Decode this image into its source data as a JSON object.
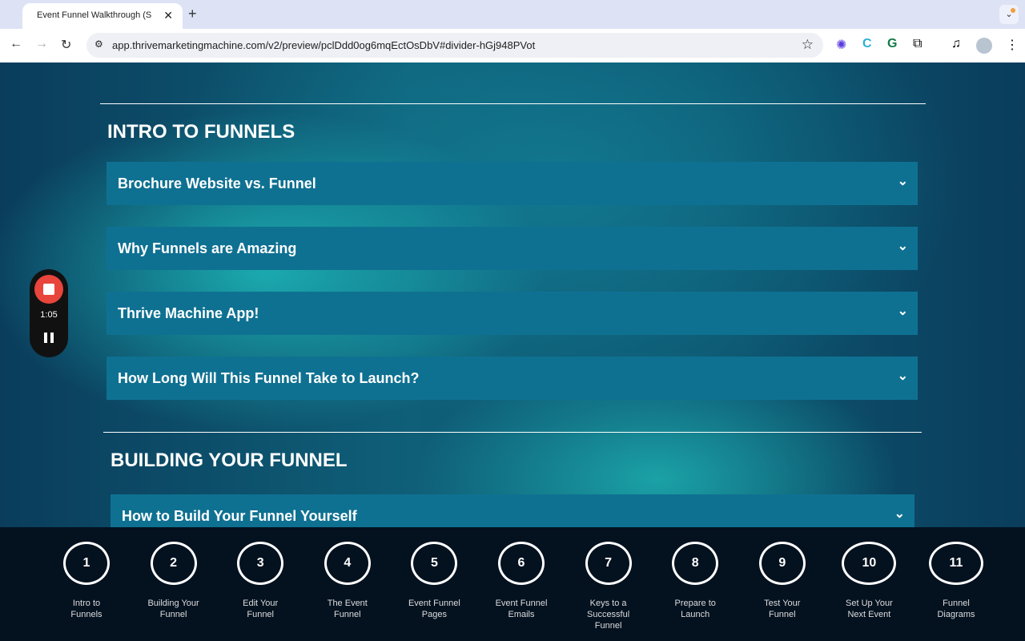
{
  "browser": {
    "tab_title": "Event Funnel Walkthrough (S",
    "url": "app.thrivemarketingmachine.com/v2/preview/pclDdd0og6mqEctOsDbV#divider-hGj948PVot"
  },
  "sections": [
    {
      "title": "INTRO TO FUNNELS",
      "items": [
        "Brochure Website vs. Funnel",
        "Why Funnels are Amazing",
        "Thrive Machine App!",
        "How Long Will This Funnel Take to Launch?"
      ]
    },
    {
      "title": "BUILDING YOUR FUNNEL",
      "items": [
        "How to Build Your Funnel Yourself"
      ]
    }
  ],
  "recorder": {
    "time": "1:05"
  },
  "steps": [
    {
      "num": "1",
      "label": "Intro to Funnels"
    },
    {
      "num": "2",
      "label": "Building Your Funnel"
    },
    {
      "num": "3",
      "label": "Edit Your Funnel"
    },
    {
      "num": "4",
      "label": "The Event Funnel"
    },
    {
      "num": "5",
      "label": "Event Funnel Pages"
    },
    {
      "num": "6",
      "label": "Event Funnel Emails"
    },
    {
      "num": "7",
      "label": "Keys to a Successful Funnel"
    },
    {
      "num": "8",
      "label": "Prepare to Launch"
    },
    {
      "num": "9",
      "label": "Test Your Funnel"
    },
    {
      "num": "10",
      "label": "Set Up Your Next Event"
    },
    {
      "num": "11",
      "label": "Funnel Diagrams"
    }
  ]
}
